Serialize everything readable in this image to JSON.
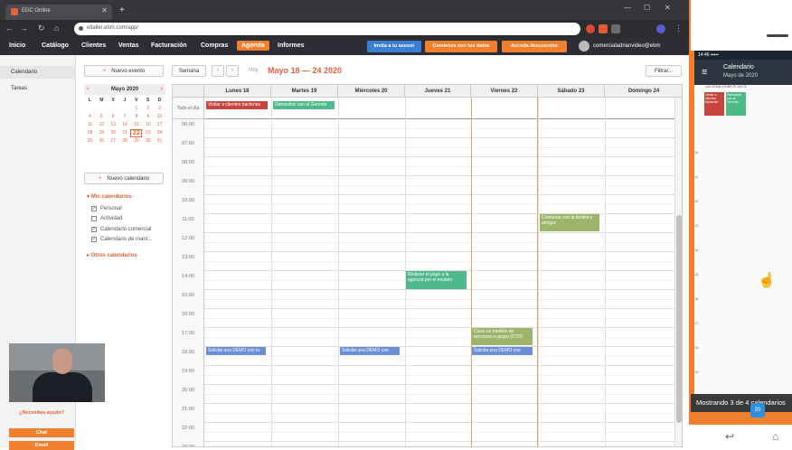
{
  "browser": {
    "tab_title": "EDC Online",
    "url": "eltaller.ebm.com/app/",
    "colors": {
      "frame": "#35363a",
      "tab": "#4a4b50"
    }
  },
  "nav": {
    "items": [
      "Inicio",
      "Catálogo",
      "Clientes",
      "Ventas",
      "Facturación",
      "Compras",
      "Agenda",
      "Informes"
    ],
    "active_item": "Agenda",
    "invite_button": "Invita a tu asesor",
    "data_button": "Comienza con tus datos",
    "discount_button": "Acceda descuentos",
    "user_email": "comercialadrianvideo@ebm",
    "colors": {
      "accent": "#f0802e",
      "blue": "#3a7fd1",
      "bar": "#2d2d35"
    }
  },
  "sidebar": {
    "items": [
      "Calendario",
      "Tareas"
    ]
  },
  "mid": {
    "new_event": "Nuevo evento",
    "mini_cal": {
      "title": "Mayo 2020",
      "weekdays": [
        "L",
        "M",
        "X",
        "J",
        "V",
        "S",
        "D"
      ],
      "days": [
        "",
        "",
        "",
        "",
        "1",
        "2",
        "3",
        "4",
        "5",
        "6",
        "7",
        "8",
        "9",
        "10",
        "11",
        "12",
        "13",
        "14",
        "15",
        "16",
        "17",
        "18",
        "19",
        "20",
        "21",
        "22",
        "23",
        "24",
        "25",
        "26",
        "27",
        "28",
        "29",
        "30",
        "31"
      ],
      "today": "22"
    },
    "new_calendar": "Nuevo calendario",
    "my_calendars": "Mis calendarios",
    "calendars": [
      {
        "label": "Personal",
        "checked": true
      },
      {
        "label": "Actividad",
        "checked": false
      },
      {
        "label": "Calendario comercial",
        "checked": true
      },
      {
        "label": "Calendario de mant...",
        "checked": true
      }
    ],
    "other_calendars": "Otros calendarios"
  },
  "toolbar": {
    "view": "Semana",
    "today": "Hoy",
    "range": "Mayo 18 — 24 2020",
    "filter": "Filtrar..."
  },
  "grid": {
    "days": [
      "Lunes 18",
      "Martes 19",
      "Miércoles 20",
      "Jueves 21",
      "Viernes 22",
      "Sábado 23",
      "Domingo 24"
    ],
    "allday_label": "Todo el día",
    "hours": [
      "06:00",
      "07:00",
      "08:00",
      "09:00",
      "10:00",
      "11:00",
      "12:00",
      "13:00",
      "14:00",
      "15:00",
      "16:00",
      "17:00",
      "18:00",
      "19:00",
      "20:00",
      "21:00",
      "22:00",
      "23:00"
    ],
    "today_index": 4,
    "events": {
      "allday_mon": "Visitar a clientes bacterias",
      "allday_tue": "Demostrar uso al Gerente",
      "sat_11": "Contactar con la familia y amigos",
      "thu_14": "Realizar el pago a la agencia por el modelo",
      "fri_17": "Crear un modelo de personas o grupo (CTO)",
      "mon_18": "Solicita una DEMO con tu",
      "wed_18": "Solicita una DEMO con",
      "fri_18": "Solicita una DEMO con"
    }
  },
  "presenter": {
    "help_label": "¿Necesitas ayuda?",
    "button1": "Chat",
    "button2": "Email"
  },
  "phone": {
    "status_time": "14:46",
    "title": "Calendario",
    "subtitle": "Mayo de 2020",
    "days": "Lun 18  Mar 19  Mié 20  Jue 21",
    "ev1": "Visitar a clientes bacterias",
    "ev2": "Demostrar uso al Gerente",
    "hours": [
      "10",
      "11",
      "12",
      "13",
      "14",
      "15",
      "16",
      "17",
      "18",
      "19",
      "20"
    ],
    "toast": "Mostrando 3 de 4 calendarios",
    "badge": "20"
  }
}
